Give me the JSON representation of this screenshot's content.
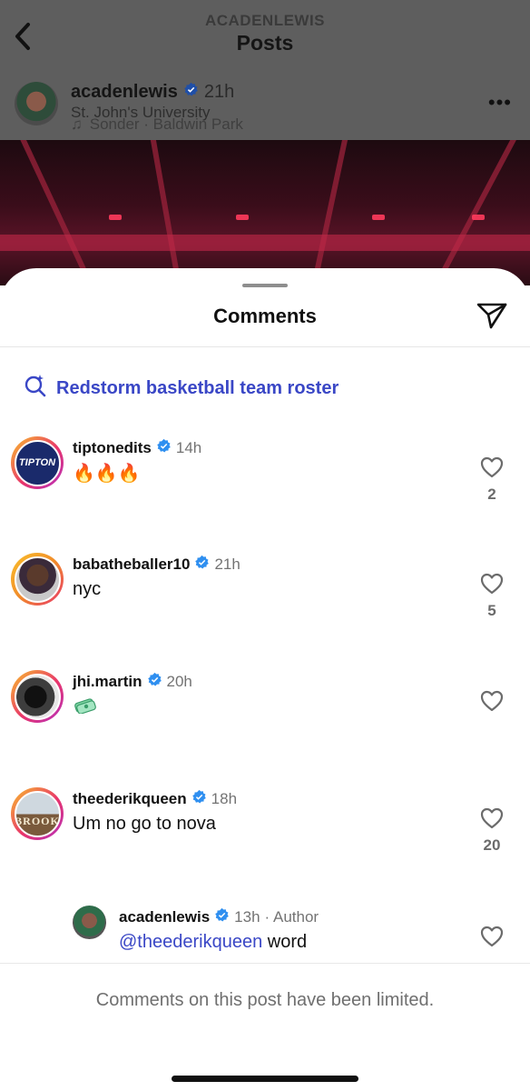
{
  "background": {
    "username_caps": "ACADENLEWIS",
    "title": "Posts",
    "author": "acadenlewis",
    "time": "21h",
    "location": "St. John's University",
    "music": "Sonder · Baldwin Park"
  },
  "sheet": {
    "title": "Comments",
    "search_suggestion": "Redstorm basketball team roster"
  },
  "comments": [
    {
      "user": "tiptonedits",
      "time": "14h",
      "text": "🔥🔥🔥",
      "likes": "2",
      "avatar_text": "TIPTON"
    },
    {
      "user": "babatheballer10",
      "time": "21h",
      "text": "nyc",
      "likes": "5"
    },
    {
      "user": "jhi.martin",
      "time": "20h",
      "text": "",
      "likes": ""
    },
    {
      "user": "theederikqueen",
      "time": "18h",
      "text": "Um no go to nova",
      "likes": "20",
      "avatar_text": "BROOK"
    }
  ],
  "reply": {
    "user": "acadenlewis",
    "time": "13h",
    "author_label": "· Author",
    "mention": "@theederikqueen",
    "text": "word"
  },
  "footer": {
    "text": "Comments on this post have been limited."
  },
  "colors": {
    "accent": "#3a47c6",
    "verified": "#2f8ff0",
    "ring_start": "#f9c02b",
    "ring_end": "#b42fc0"
  }
}
